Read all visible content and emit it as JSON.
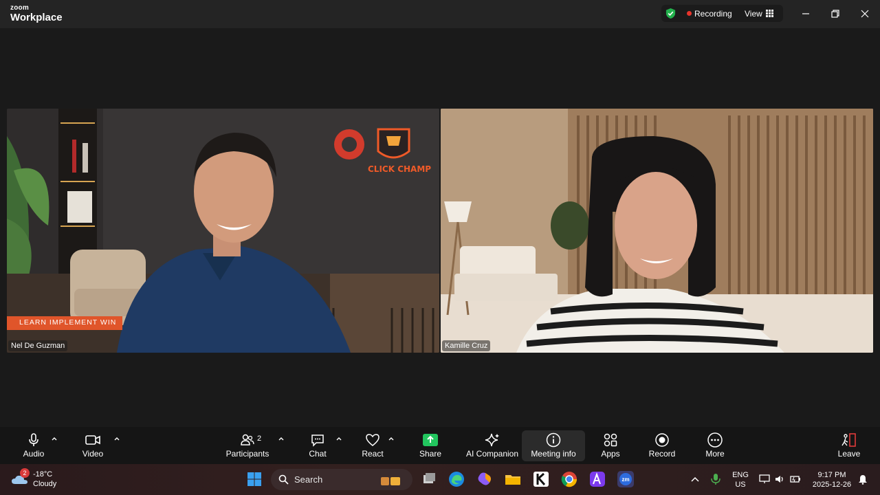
{
  "app": {
    "brand_small": "zoom",
    "brand_big": "Workplace"
  },
  "status": {
    "recording_label": "Recording",
    "view_label": "View"
  },
  "participants_video": [
    {
      "name": "Nel De Guzman",
      "banner": "LEARN  IMPLEMENT  WIN",
      "logo_text": "CLICK CHAMP"
    },
    {
      "name": "Kamille Cruz"
    }
  ],
  "toolbar": {
    "audio": "Audio",
    "video": "Video",
    "participants": "Participants",
    "participants_count": "2",
    "chat": "Chat",
    "react": "React",
    "share": "Share",
    "ai_companion": "AI Companion",
    "meeting_info": "Meeting info",
    "apps": "Apps",
    "record": "Record",
    "more": "More",
    "leave": "Leave"
  },
  "taskbar": {
    "weather_badge": "2",
    "weather_temp": "-18°C",
    "weather_desc": "Cloudy",
    "search_label": "Search",
    "lang_top": "ENG",
    "lang_bottom": "US",
    "time": "9:17 PM",
    "date": "2025-12-26"
  },
  "colors": {
    "accent_green": "#22c55e",
    "record_red": "#e8342b",
    "leave_red": "#e23b3b",
    "banner_orange": "#e0552a"
  }
}
